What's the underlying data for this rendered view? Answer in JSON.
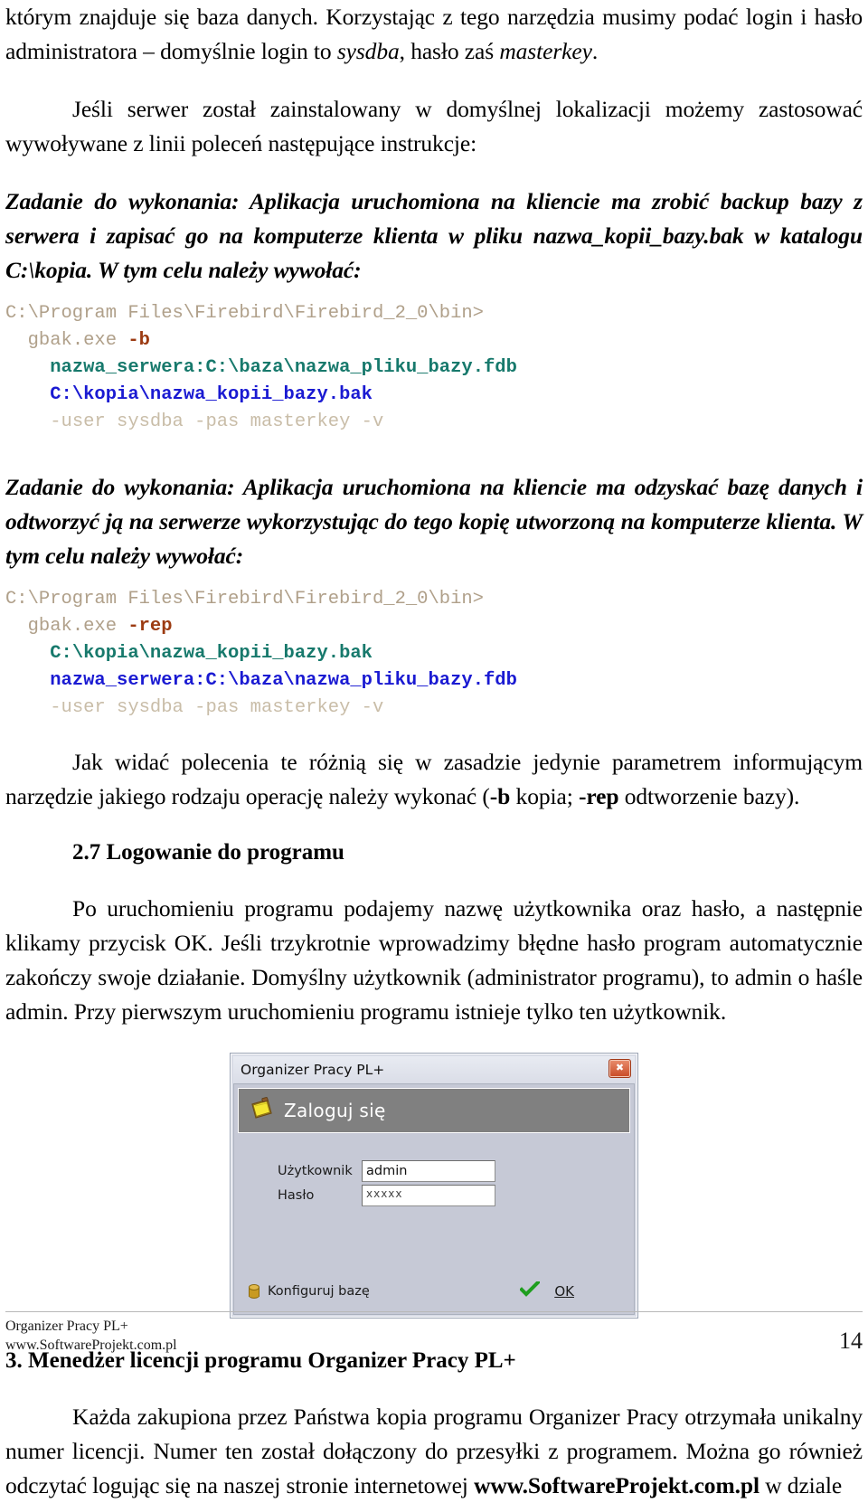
{
  "document": {
    "paragraphs": {
      "p_intro_line1": "którym znajduje się baza danych. Korzystając z tego narzędzia musimy podać login i hasło",
      "p_intro_line2_a": "administratora – domyślnie login to ",
      "p_intro_login": "sysdba",
      "p_intro_line2_b": ", hasło zaś ",
      "p_intro_password": "masterkey",
      "p_intro_line2_c": ".",
      "p_server": "Jeśli serwer został zainstalowany w domyślnej lokalizacji możemy zastosować wywoływane z linii poleceń następujące instrukcje:",
      "p_task1": "Zadanie do wykonania: Aplikacja uruchomiona na kliencie ma zrobić backup bazy z serwera i zapisać go na komputerze klienta w pliku nazwa_kopii_bazy.bak w katalogu C:\\kopia. W tym celu należy wywołać:",
      "p_task2": "Zadanie do wykonania: Aplikacja uruchomiona na kliencie ma odzyskać bazę danych i odtworzyć ją na serwerze wykorzystując do tego kopię utworzoną na komputerze klienta. W tym celu należy wywołać:",
      "p_diff_a": "Jak widać polecenia te różnią się w zasadzie jedynie parametrem informującym narzędzie jakiego rodzaju operację należy wykonać (",
      "p_diff_flag1": "-b",
      "p_diff_b": " kopia;   ",
      "p_diff_flag2": "-rep",
      "p_diff_c": " odtworzenie bazy).",
      "p_login_desc": "Po uruchomieniu programu podajemy nazwę użytkownika oraz hasło, a następnie klikamy przycisk OK. Jeśli trzykrotnie wprowadzimy błędne hasło program automatycznie zakończy swoje działanie. Domyślny użytkownik (administrator programu), to admin o haśle admin. Przy pierwszym uruchomieniu programu istnieje tylko ten użytkownik.",
      "p_license_a": "Każda zakupiona przez Państwa kopia programu Organizer Pracy otrzymała unikalny numer licencji. Numer ten został dołączony do przesyłki z programem. Można go również odczytać logując się na naszej stronie internetowej ",
      "p_license_site": "www.SoftwareProjekt.com.pl",
      "p_license_b": " w dziale"
    },
    "headings": {
      "h_27": "2.7 Logowanie do programu",
      "h_3": "3. Menedżer licencji programu Organizer Pracy PL+"
    },
    "code_block_backup": {
      "line1": "C:\\Program Files\\Firebird\\Firebird_2_0\\bin>",
      "line2_cmd": "gbak.exe ",
      "line2_flag": "-b",
      "line3": "nazwa_serwera:C:\\baza\\nazwa_pliku_bazy.fdb",
      "line4": "C:\\kopia\\nazwa_kopii_bazy.bak",
      "line5": "-user sysdba -pas masterkey -v"
    },
    "code_block_restore": {
      "line1": "C:\\Program Files\\Firebird\\Firebird_2_0\\bin>",
      "line2_cmd": "gbak.exe ",
      "line2_flag": "-rep",
      "line3": "C:\\kopia\\nazwa_kopii_bazy.bak",
      "line4": "nazwa_serwera:C:\\baza\\nazwa_pliku_bazy.fdb",
      "line5": "-user sysdba -pas masterkey -v"
    },
    "footer": {
      "line1": "Organizer Pracy PL+",
      "line2": "www.SoftwareProjekt.com.pl",
      "page_number": "14"
    }
  },
  "screenshot_dialog": {
    "window_title": "Organizer Pracy PL+",
    "close_glyph": "✖",
    "header_title": "Zaloguj się",
    "header_icon": "notepad-icon",
    "fields": [
      {
        "label": "Użytkownik",
        "value": "admin"
      },
      {
        "label": "Hasło",
        "value": "xxxxx"
      }
    ],
    "configure_db_label": "Konfiguruj bazę",
    "configure_db_icon": "database-cylinder-icon",
    "ok_label": "OK",
    "ok_icon": "green-check-icon",
    "colors": {
      "header_bar": "#808080",
      "dialog_face": "#c6c9d6",
      "close_button": "#c94a24",
      "check_green": "#1f9e1f",
      "icon_yellow": "#f5e733"
    }
  }
}
